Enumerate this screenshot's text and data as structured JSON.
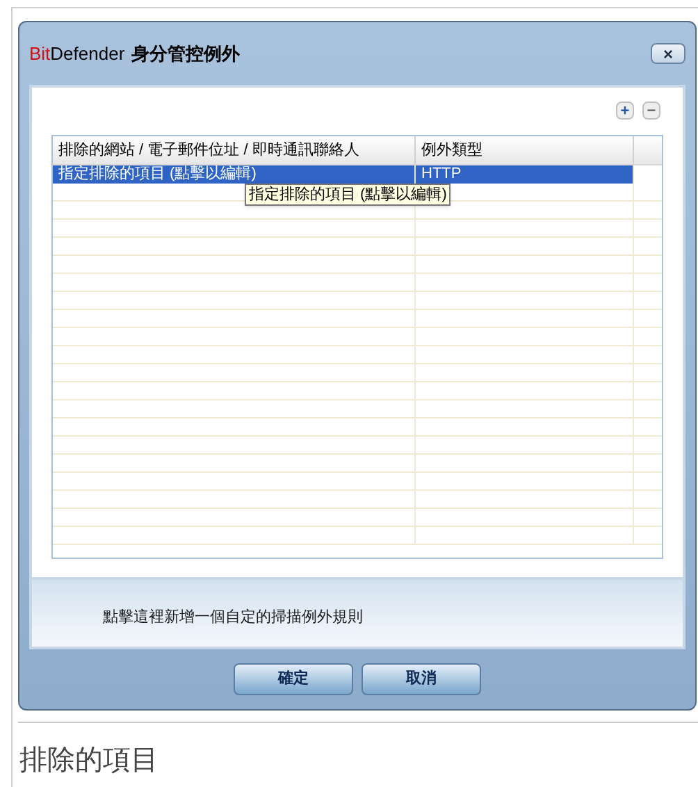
{
  "dialog": {
    "brand_prefix": "Bit",
    "brand_rest": "Defender",
    "title": "身分管控例外",
    "close": "×"
  },
  "toolbar": {
    "add": "+",
    "remove": "−"
  },
  "table": {
    "columns": [
      "排除的網站 / 電子郵件位址 / 即時通訊聯絡人",
      "例外類型"
    ],
    "rows": [
      {
        "cells": [
          "指定排除的項目 (點擊以編輯)",
          "HTTP"
        ],
        "selected": true
      }
    ]
  },
  "tooltip": "指定排除的項目 (點擊以編輯)",
  "hint": "點擊這裡新增一個自定的掃描例外規則",
  "buttons": [
    "確定",
    "取消"
  ],
  "caption": "排除的項目"
}
